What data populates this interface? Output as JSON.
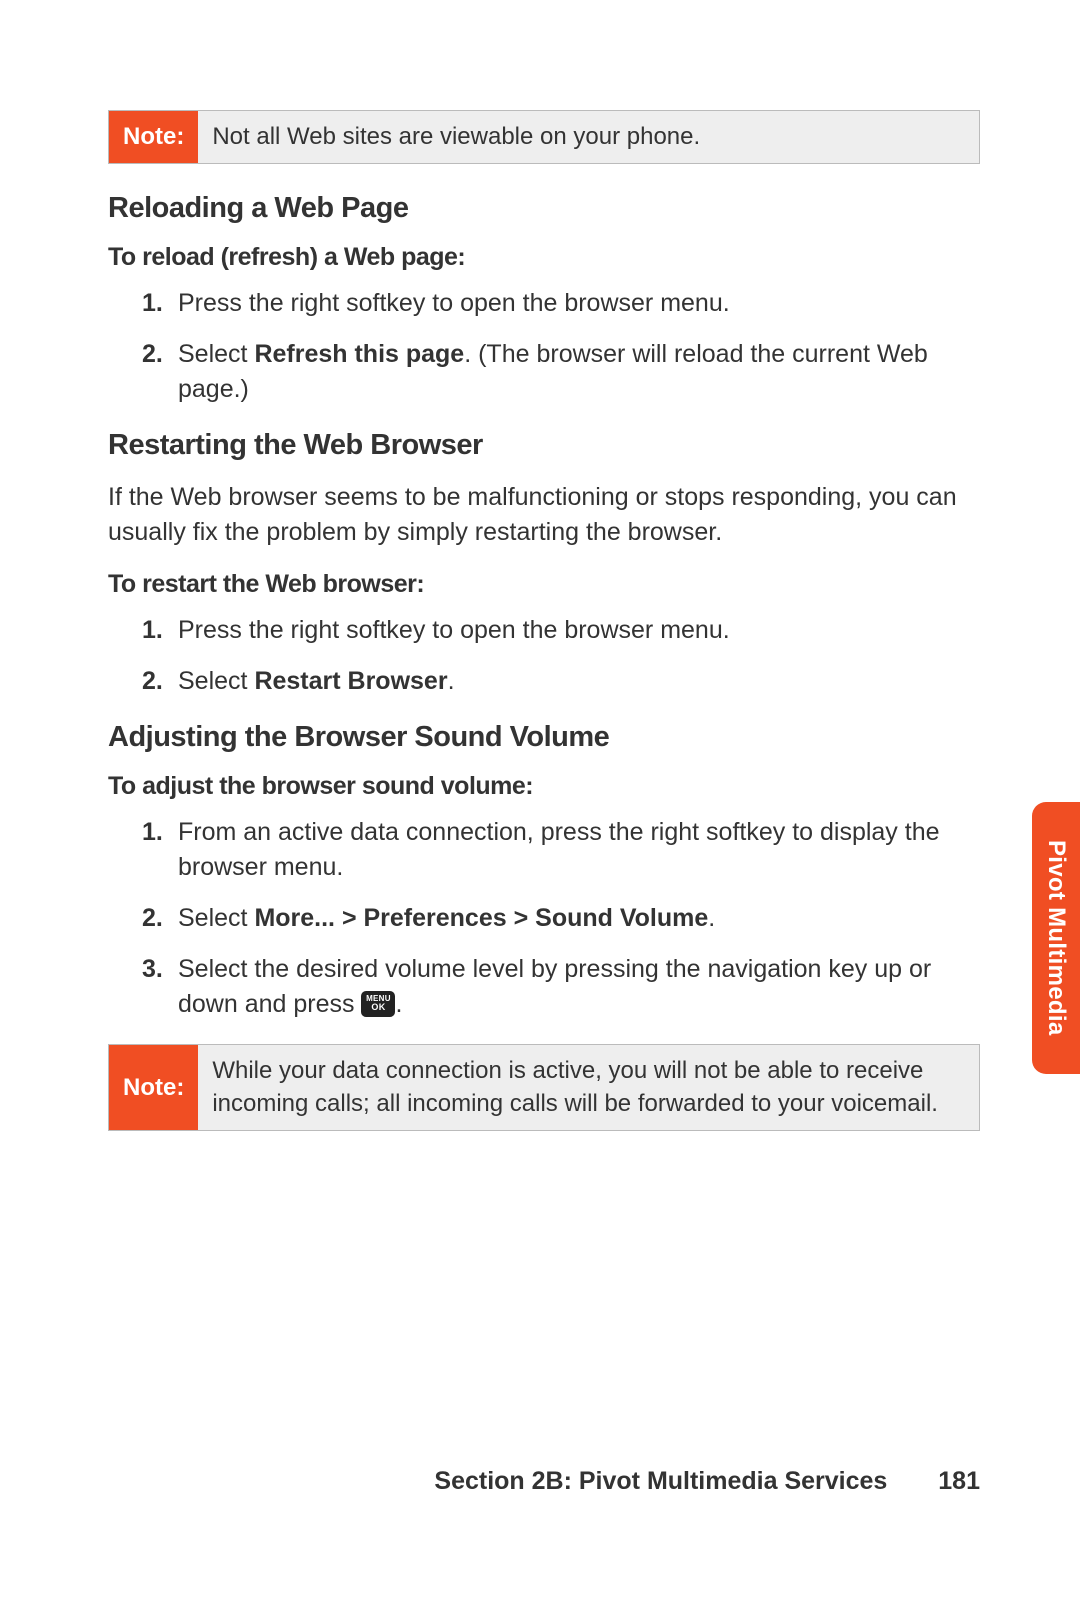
{
  "note1": {
    "label": "Note:",
    "text": "Not all Web sites are viewable on your phone."
  },
  "section1": {
    "heading": "Reloading a Web Page",
    "sub": "To reload (refresh) a Web page:",
    "steps": [
      {
        "num": "1.",
        "plain": "Press the right softkey to open the browser menu."
      },
      {
        "num": "2.",
        "pre": "Select ",
        "bold": "Refresh this page",
        "post": ". (The browser will reload the current Web page.)"
      }
    ]
  },
  "section2": {
    "heading": "Restarting the Web Browser",
    "intro": "If the Web browser seems to be malfunctioning or stops responding, you can usually fix the problem by simply restarting the browser.",
    "sub": "To restart the Web browser:",
    "steps": [
      {
        "num": "1.",
        "plain": "Press the right softkey to open the browser menu."
      },
      {
        "num": "2.",
        "pre": "Select ",
        "bold": "Restart Browser",
        "post": "."
      }
    ]
  },
  "section3": {
    "heading": "Adjusting the Browser Sound Volume",
    "sub": "To adjust the browser sound volume:",
    "steps": [
      {
        "num": "1.",
        "plain": "From an active data connection, press the right softkey to display the browser menu."
      },
      {
        "num": "2.",
        "pre": "Select ",
        "bold": "More... > Preferences > Sound Volume",
        "post": "."
      },
      {
        "num": "3.",
        "pre": "Select the desired volume level by pressing the navigation key up or down and press ",
        "key": {
          "l1": "MENU",
          "l2": "OK"
        },
        "post": "."
      }
    ]
  },
  "note2": {
    "label": "Note:",
    "text": "While your data connection is active, you will not be able to receive incoming calls; all incoming calls will be forwarded to your voicemail."
  },
  "side_tab": "Pivot Multimedia",
  "footer": {
    "section": "Section 2B: Pivot Multimedia Services",
    "page": "181"
  }
}
